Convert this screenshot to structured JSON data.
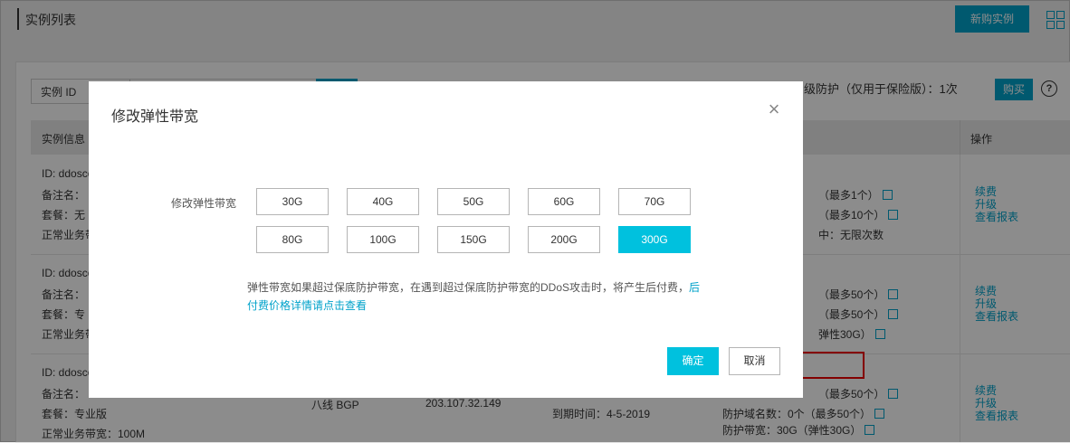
{
  "header": {
    "title": "实例列表",
    "new_instance_label": "新购实例",
    "grid_icon": "grid-icon"
  },
  "filter": {
    "select_label": "实例 ID",
    "protection_text": "级防护（仅用于保险版）：1次",
    "buy_label": "购买",
    "help_icon": "?"
  },
  "table": {
    "columns": {
      "info": "实例信息",
      "ops": "操作"
    },
    "rows": [
      {
        "id": "ID: ddoscoo",
        "remark": "备注名：",
        "plan": "套餐：无",
        "bandwidth": "正常业务带",
        "right_lines": [
          "（最多1个）",
          "（最多10个）",
          "中：无限次数"
        ],
        "ops": [
          "续费",
          "升级",
          "查看报表"
        ]
      },
      {
        "id": "ID: ddosco",
        "remark": "备注名：",
        "plan": "套餐：专",
        "bandwidth": "正常业务带",
        "right_lines": [
          "（最多50个）",
          "（最多50个）",
          "弹性30G）"
        ],
        "ops": [
          "续费",
          "升级",
          "查看报表"
        ]
      },
      {
        "id": "ID: ddosco",
        "remark": "备注名：",
        "plan": "套餐：专业版",
        "bandwidth": "正常业务带宽：100M",
        "line_type": "八线 BGP",
        "ip": "203.107.32.149",
        "expire": "到期时间：4-5-2019",
        "right_lines": [
          "（最多50个）",
          "防护域名数：0个（最多50个）",
          "防护带宽：30G（弹性30G）"
        ],
        "ops": [
          "续费",
          "升级",
          "查看报表"
        ]
      }
    ]
  },
  "dialog": {
    "title": "修改弹性带宽",
    "field_label": "修改弹性带宽",
    "options_row1": [
      "30G",
      "40G",
      "50G",
      "60G",
      "70G"
    ],
    "options_row2": [
      "80G",
      "100G",
      "150G",
      "200G",
      "300G"
    ],
    "selected": "300G",
    "note_text": "弹性带宽如果超过保底防护带宽，在遇到超过保底防护带宽的DDoS攻击时，将产生后付费，",
    "note_link_a": "后",
    "note_link_b": "付费价格详情请点击查看",
    "ok_label": "确定",
    "cancel_label": "取消"
  },
  "colors": {
    "accent": "#00c1de",
    "primary": "#00a2ca",
    "highlight": "#e00000"
  }
}
